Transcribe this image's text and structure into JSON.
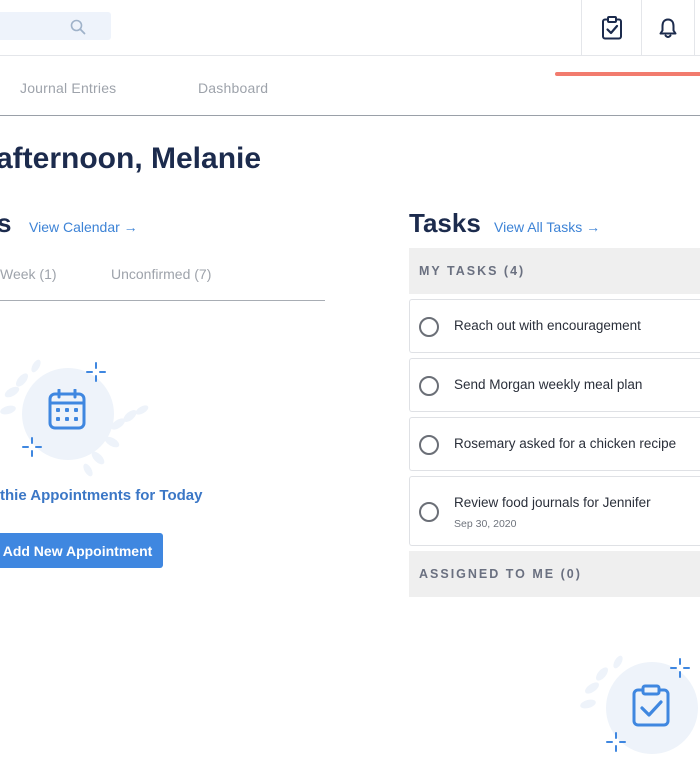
{
  "nav": {
    "links": [
      "Journal Entries",
      "Dashboard"
    ]
  },
  "greeting": "afternoon, Melanie",
  "appointments": {
    "title_fragment": "s",
    "view_link": "View Calendar →",
    "tabs": [
      "Week (1)",
      "Unconfirmed (7)"
    ],
    "empty_text": "thie Appointments for Today",
    "add_button": "Add New Appointment"
  },
  "tasks": {
    "title": "Tasks",
    "view_link": "View All Tasks →",
    "my_tasks_label": "MY TASKS (4)",
    "items": [
      {
        "text": "Reach out with encouragement",
        "completed": false
      },
      {
        "text": "Send Morgan weekly meal plan",
        "completed": false
      },
      {
        "text": "Rosemary asked for a chicken recipe",
        "completed": false
      },
      {
        "text": "Review food journals for Jennifer",
        "date": "Sep 30, 2020",
        "completed": false
      }
    ],
    "assigned_label": "ASSIGNED TO ME (0)"
  },
  "colors": {
    "accent_blue": "#3f87e0",
    "nav_active": "#f27b6e",
    "heading": "#1c2b4d"
  },
  "icons": [
    "search-icon",
    "tasks-clipboard-icon",
    "bell-icon",
    "calendar-icon",
    "clipboard-check-icon",
    "sparkle-icon"
  ]
}
